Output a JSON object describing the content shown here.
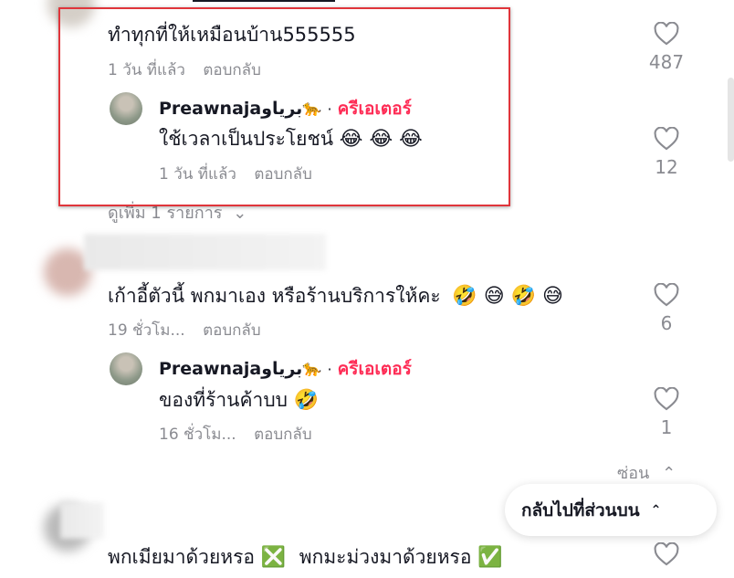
{
  "comments": [
    {
      "text": "ทำทุกที่ให้เหมือนบ้าน555555",
      "time": "1 วัน ที่แล้ว",
      "reply_label": "ตอบกลับ",
      "likes": "487",
      "reply": {
        "username": "Preawnajaبرياو",
        "username_emoji": "🐆",
        "separator": "·",
        "creator_badge": "ครีเอเตอร์",
        "text": "ใช้เวลาเป็นประโยชน์",
        "emojis": "😂 😂 😂",
        "time": "1 วัน ที่แล้ว",
        "reply_label": "ตอบกลับ",
        "likes": "12"
      },
      "view_more": "ดูเพิ่ม 1 รายการ"
    },
    {
      "text": "เก้าอี้ตัวนี้ พกมาเอง หรือร้านบริการให้คะ",
      "emojis": "🤣 😅 🤣 😅",
      "time": "19 ชั่วโม...",
      "reply_label": "ตอบกลับ",
      "likes": "6",
      "reply": {
        "username": "Preawnajaبرياو",
        "username_emoji": "🐆",
        "separator": "·",
        "creator_badge": "ครีเอเตอร์",
        "text": "ของที่ร้านค้าบบ",
        "emojis": "🤣",
        "time": "16 ชั่วโม...",
        "reply_label": "ตอบกลับ",
        "likes": "1"
      },
      "hide_label": "ซ่อน"
    },
    {
      "text_a": "พกเมียมาด้วยหรอ",
      "emoji_a": "❎",
      "text_b": "พกมะม่วงมาด้วยหรอ",
      "emoji_b": "✅"
    }
  ],
  "back_to_top": "กลับไปที่ส่วนบน",
  "colors": {
    "creator": "#fe2c55",
    "highlight": "#e0353b",
    "muted": "#8a8b91"
  }
}
